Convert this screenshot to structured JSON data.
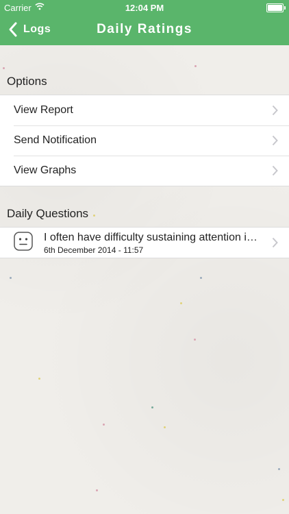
{
  "status_bar": {
    "carrier": "Carrier",
    "time": "12:04 PM"
  },
  "nav": {
    "back_label": "Logs",
    "title": "Daily Ratings"
  },
  "options": {
    "header": "Options",
    "items": [
      {
        "label": "View Report"
      },
      {
        "label": "Send Notification"
      },
      {
        "label": "View Graphs"
      }
    ]
  },
  "daily_questions": {
    "header": "Daily Questions",
    "items": [
      {
        "text": "I often have difficulty sustaining attention in tasks or fun activities",
        "date": "6th December 2014 - 11:57",
        "icon": "neutral-face-icon"
      }
    ]
  },
  "colors": {
    "nav_bar": "#5ab56b",
    "background": "#f0eeea"
  }
}
